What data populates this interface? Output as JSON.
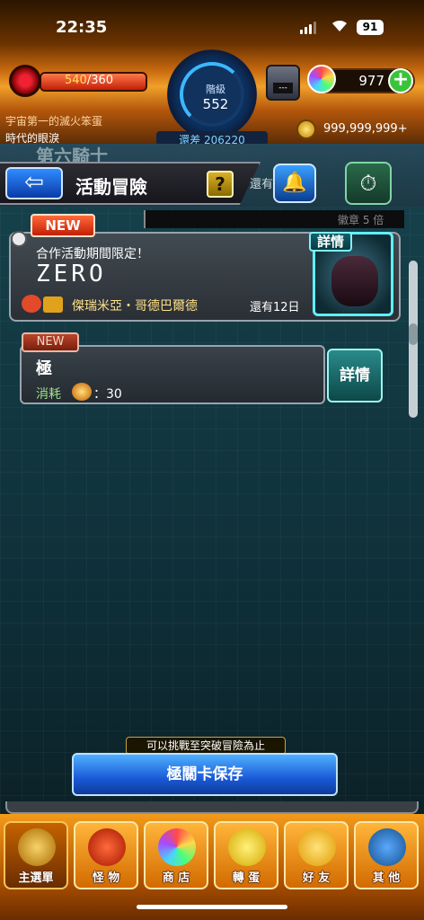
{
  "status_bar": {
    "time": "22:35",
    "battery": "91"
  },
  "hud": {
    "stamina_current": "540",
    "stamina_max": "/360",
    "rank_label": "階級",
    "rank_value": "552",
    "rank_diff": "還差 206220",
    "box_label": "---",
    "orbs": "977",
    "gold": "999,999,999+",
    "news_line1": "宇宙第一的滅火笨蛋",
    "news_line2": "時代的眼淚"
  },
  "header": {
    "back_label": "⇦",
    "title": "活動冒險",
    "help_label": "?",
    "side_text": "還有",
    "ghost_title": "第六騎士",
    "badge_text": "徽章 5 倍"
  },
  "event": {
    "new_label": "NEW",
    "subtitle": "合作活動期間限定！",
    "name": "ZERO",
    "boss": "傑瑞米亞・哥德巴爾德",
    "days_left": "還有12日",
    "detail_label": "詳情"
  },
  "difficulty": {
    "new_label": "NEW",
    "name": "極",
    "cost_label": "消耗",
    "cost_value": "：30",
    "detail_label": "詳情"
  },
  "save": {
    "note": "可以挑戰至突破冒險為止",
    "button": "極關卡保存"
  },
  "nav": {
    "items": [
      {
        "label": "主選單"
      },
      {
        "label": "怪 物"
      },
      {
        "label": "商 店"
      },
      {
        "label": "轉 蛋"
      },
      {
        "label": "好 友"
      },
      {
        "label": "其 他"
      }
    ]
  },
  "colors": {
    "accent_orange": "#f0a02a",
    "accent_blue": "#1a5ad8",
    "detail_cyan": "#5ff0ff"
  }
}
